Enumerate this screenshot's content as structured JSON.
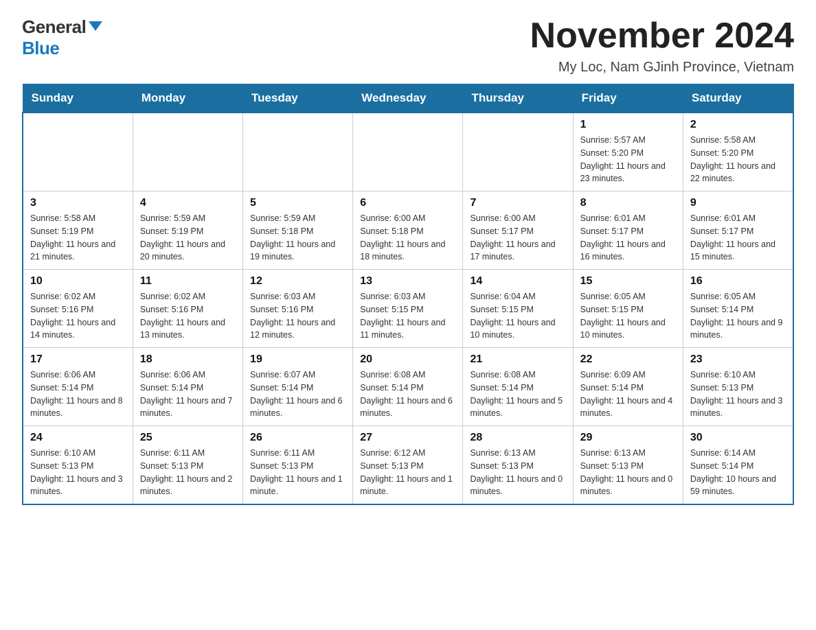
{
  "logo": {
    "general": "General",
    "blue": "Blue"
  },
  "title": "November 2024",
  "subtitle": "My Loc, Nam GJinh Province, Vietnam",
  "days_of_week": [
    "Sunday",
    "Monday",
    "Tuesday",
    "Wednesday",
    "Thursday",
    "Friday",
    "Saturday"
  ],
  "weeks": [
    [
      {
        "day": "",
        "info": ""
      },
      {
        "day": "",
        "info": ""
      },
      {
        "day": "",
        "info": ""
      },
      {
        "day": "",
        "info": ""
      },
      {
        "day": "",
        "info": ""
      },
      {
        "day": "1",
        "info": "Sunrise: 5:57 AM\nSunset: 5:20 PM\nDaylight: 11 hours and 23 minutes."
      },
      {
        "day": "2",
        "info": "Sunrise: 5:58 AM\nSunset: 5:20 PM\nDaylight: 11 hours and 22 minutes."
      }
    ],
    [
      {
        "day": "3",
        "info": "Sunrise: 5:58 AM\nSunset: 5:19 PM\nDaylight: 11 hours and 21 minutes."
      },
      {
        "day": "4",
        "info": "Sunrise: 5:59 AM\nSunset: 5:19 PM\nDaylight: 11 hours and 20 minutes."
      },
      {
        "day": "5",
        "info": "Sunrise: 5:59 AM\nSunset: 5:18 PM\nDaylight: 11 hours and 19 minutes."
      },
      {
        "day": "6",
        "info": "Sunrise: 6:00 AM\nSunset: 5:18 PM\nDaylight: 11 hours and 18 minutes."
      },
      {
        "day": "7",
        "info": "Sunrise: 6:00 AM\nSunset: 5:17 PM\nDaylight: 11 hours and 17 minutes."
      },
      {
        "day": "8",
        "info": "Sunrise: 6:01 AM\nSunset: 5:17 PM\nDaylight: 11 hours and 16 minutes."
      },
      {
        "day": "9",
        "info": "Sunrise: 6:01 AM\nSunset: 5:17 PM\nDaylight: 11 hours and 15 minutes."
      }
    ],
    [
      {
        "day": "10",
        "info": "Sunrise: 6:02 AM\nSunset: 5:16 PM\nDaylight: 11 hours and 14 minutes."
      },
      {
        "day": "11",
        "info": "Sunrise: 6:02 AM\nSunset: 5:16 PM\nDaylight: 11 hours and 13 minutes."
      },
      {
        "day": "12",
        "info": "Sunrise: 6:03 AM\nSunset: 5:16 PM\nDaylight: 11 hours and 12 minutes."
      },
      {
        "day": "13",
        "info": "Sunrise: 6:03 AM\nSunset: 5:15 PM\nDaylight: 11 hours and 11 minutes."
      },
      {
        "day": "14",
        "info": "Sunrise: 6:04 AM\nSunset: 5:15 PM\nDaylight: 11 hours and 10 minutes."
      },
      {
        "day": "15",
        "info": "Sunrise: 6:05 AM\nSunset: 5:15 PM\nDaylight: 11 hours and 10 minutes."
      },
      {
        "day": "16",
        "info": "Sunrise: 6:05 AM\nSunset: 5:14 PM\nDaylight: 11 hours and 9 minutes."
      }
    ],
    [
      {
        "day": "17",
        "info": "Sunrise: 6:06 AM\nSunset: 5:14 PM\nDaylight: 11 hours and 8 minutes."
      },
      {
        "day": "18",
        "info": "Sunrise: 6:06 AM\nSunset: 5:14 PM\nDaylight: 11 hours and 7 minutes."
      },
      {
        "day": "19",
        "info": "Sunrise: 6:07 AM\nSunset: 5:14 PM\nDaylight: 11 hours and 6 minutes."
      },
      {
        "day": "20",
        "info": "Sunrise: 6:08 AM\nSunset: 5:14 PM\nDaylight: 11 hours and 6 minutes."
      },
      {
        "day": "21",
        "info": "Sunrise: 6:08 AM\nSunset: 5:14 PM\nDaylight: 11 hours and 5 minutes."
      },
      {
        "day": "22",
        "info": "Sunrise: 6:09 AM\nSunset: 5:14 PM\nDaylight: 11 hours and 4 minutes."
      },
      {
        "day": "23",
        "info": "Sunrise: 6:10 AM\nSunset: 5:13 PM\nDaylight: 11 hours and 3 minutes."
      }
    ],
    [
      {
        "day": "24",
        "info": "Sunrise: 6:10 AM\nSunset: 5:13 PM\nDaylight: 11 hours and 3 minutes."
      },
      {
        "day": "25",
        "info": "Sunrise: 6:11 AM\nSunset: 5:13 PM\nDaylight: 11 hours and 2 minutes."
      },
      {
        "day": "26",
        "info": "Sunrise: 6:11 AM\nSunset: 5:13 PM\nDaylight: 11 hours and 1 minute."
      },
      {
        "day": "27",
        "info": "Sunrise: 6:12 AM\nSunset: 5:13 PM\nDaylight: 11 hours and 1 minute."
      },
      {
        "day": "28",
        "info": "Sunrise: 6:13 AM\nSunset: 5:13 PM\nDaylight: 11 hours and 0 minutes."
      },
      {
        "day": "29",
        "info": "Sunrise: 6:13 AM\nSunset: 5:13 PM\nDaylight: 11 hours and 0 minutes."
      },
      {
        "day": "30",
        "info": "Sunrise: 6:14 AM\nSunset: 5:14 PM\nDaylight: 10 hours and 59 minutes."
      }
    ]
  ]
}
